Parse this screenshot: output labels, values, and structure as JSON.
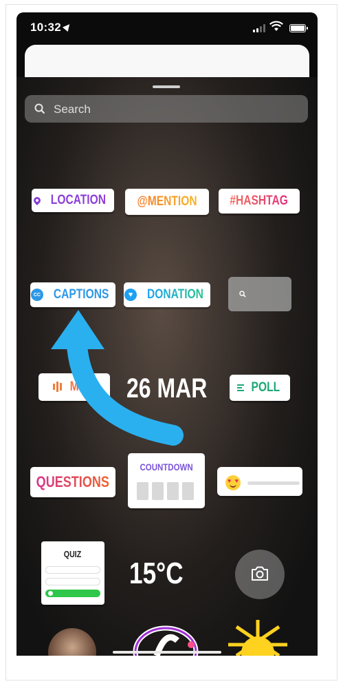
{
  "status_bar": {
    "time": "10:32"
  },
  "search": {
    "placeholder": "Search"
  },
  "stickers": {
    "location": "LOCATION",
    "mention": "@MENTION",
    "hashtag": "#HASHTAG",
    "captions": "CAPTIONS",
    "donation": "DONATION",
    "music": "M    IC",
    "date": "26 MAR",
    "poll": "POLL",
    "questions": "QUESTIONS",
    "countdown": "COUNTDOWN",
    "quiz": "QUIZ",
    "temperature": "15°C"
  },
  "icons": [
    "location-pin-icon",
    "captions-cc-icon",
    "donation-heart-icon",
    "music-bars-icon",
    "poll-icon",
    "heart-eyes-emoji-icon",
    "camera-icon",
    "search-icon",
    "location-arrow-icon"
  ],
  "colors": {
    "location": "#8b3fd9",
    "captions": "#2d97e6",
    "poll": "#1aa876",
    "arrow": "#2ab0ef",
    "quiz_correct": "#2ec74a"
  }
}
